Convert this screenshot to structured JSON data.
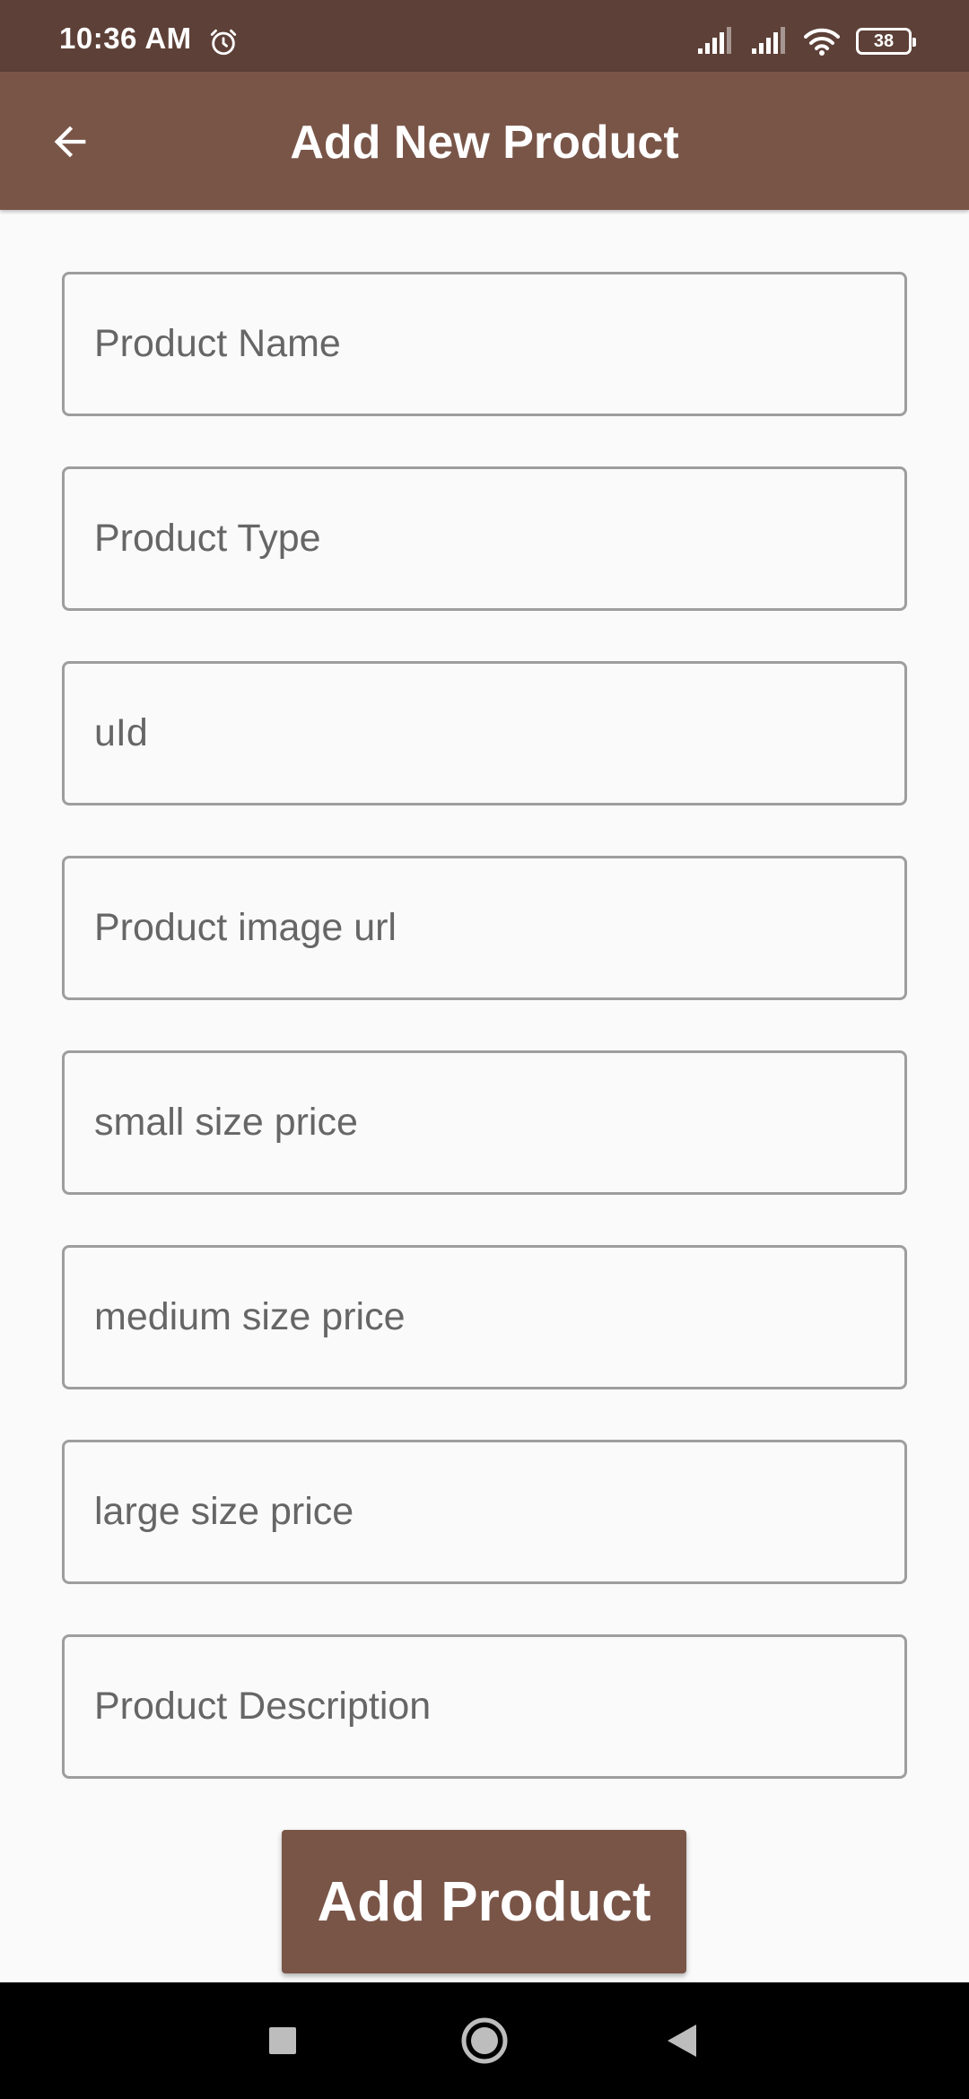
{
  "status_bar": {
    "time": "10:36 AM",
    "alarm_icon": "alarm-clock-icon",
    "battery_level": "38",
    "icons": [
      "signal-icon",
      "signal-icon",
      "wifi-icon",
      "battery-icon"
    ]
  },
  "app_bar": {
    "title": "Add New Product",
    "back_icon": "arrow-left-icon"
  },
  "form": {
    "fields": [
      {
        "placeholder": "Product Name",
        "value": ""
      },
      {
        "placeholder": "Product Type",
        "value": ""
      },
      {
        "placeholder": "uId",
        "value": ""
      },
      {
        "placeholder": "Product image url",
        "value": ""
      },
      {
        "placeholder": "small size price",
        "value": ""
      },
      {
        "placeholder": "medium size price",
        "value": ""
      },
      {
        "placeholder": "large size price",
        "value": ""
      },
      {
        "placeholder": "Product Description",
        "value": ""
      }
    ],
    "submit_label": "Add Product"
  },
  "nav_bar": {
    "icons": [
      "recent-apps-icon",
      "home-icon",
      "back-icon"
    ]
  },
  "colors": {
    "status_bar": "#5d4037",
    "app_bar": "#795548",
    "button": "#795548",
    "background": "#fafafa",
    "field_border": "#9e9e9e"
  }
}
